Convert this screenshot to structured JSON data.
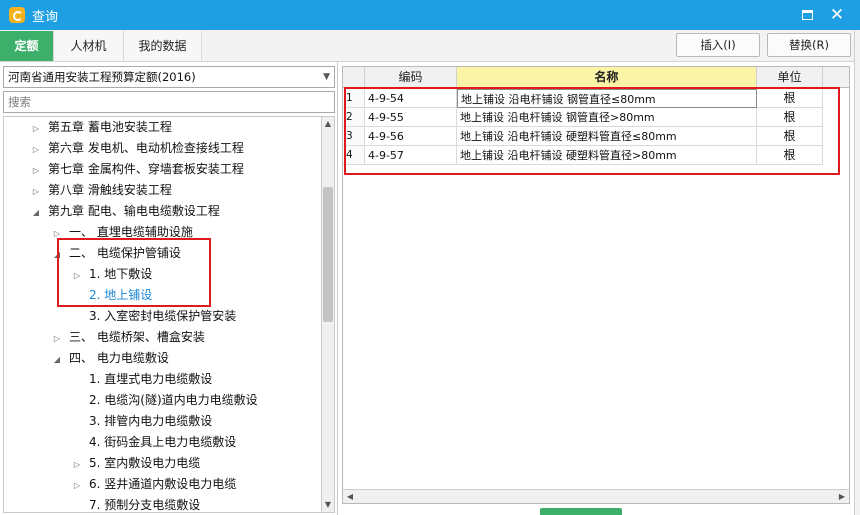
{
  "window": {
    "title": "查询",
    "maximize_icon": "maximize-icon",
    "close_glyph": "✕"
  },
  "tabs": [
    {
      "label": "定额",
      "active": true
    },
    {
      "label": "人材机",
      "active": false
    },
    {
      "label": "我的数据",
      "active": false
    }
  ],
  "toolbar": {
    "insert_label": "插入(I)",
    "replace_label": "替换(R)"
  },
  "left": {
    "quota_book": "河南省通用安装工程预算定额(2016)",
    "search_placeholder": "搜索",
    "tree": [
      {
        "label": "第五章 蓄电池安装工程",
        "level": 0,
        "toggle": "▷"
      },
      {
        "label": "第六章 发电机、电动机检查接线工程",
        "level": 0,
        "toggle": "▷"
      },
      {
        "label": "第七章 金属构件、穿墙套板安装工程",
        "level": 0,
        "toggle": "▷"
      },
      {
        "label": "第八章 滑触线安装工程",
        "level": 0,
        "toggle": "▷"
      },
      {
        "label": "第九章 配电、输电电缆敷设工程",
        "level": 0,
        "toggle": "◢"
      },
      {
        "label": "一、 直埋电缆辅助设施",
        "level": 1,
        "toggle": "▷"
      },
      {
        "label": "二、 电缆保护管铺设",
        "level": 1,
        "toggle": "◢"
      },
      {
        "label": "1. 地下敷设",
        "level": 2,
        "toggle": "▷"
      },
      {
        "label": "2. 地上铺设",
        "level": 2,
        "toggle": "",
        "selected": true
      },
      {
        "label": "3. 入室密封电缆保护管安装",
        "level": 2,
        "toggle": ""
      },
      {
        "label": "三、 电缆桥架、槽盒安装",
        "level": 1,
        "toggle": "▷"
      },
      {
        "label": "四、 电力电缆敷设",
        "level": 1,
        "toggle": "◢"
      },
      {
        "label": "1. 直埋式电力电缆敷设",
        "level": 2,
        "toggle": ""
      },
      {
        "label": "2. 电缆沟(隧)道内电力电缆敷设",
        "level": 2,
        "toggle": ""
      },
      {
        "label": "3. 排管内电力电缆敷设",
        "level": 2,
        "toggle": ""
      },
      {
        "label": "4. 街码金具上电力电缆敷设",
        "level": 2,
        "toggle": ""
      },
      {
        "label": "5. 室内敷设电力电缆",
        "level": 2,
        "toggle": "▷"
      },
      {
        "label": "6. 竖井通道内敷设电力电缆",
        "level": 2,
        "toggle": "▷"
      },
      {
        "label": "7. 预制分支电缆敷设",
        "level": 2,
        "toggle": ""
      }
    ]
  },
  "table": {
    "headers": {
      "code": "编码",
      "name": "名称",
      "unit": "单位"
    },
    "rows": [
      {
        "no": "1",
        "code": "4-9-54",
        "name": "地上铺设 沿电杆铺设 钢管直径≤80mm",
        "unit": "根"
      },
      {
        "no": "2",
        "code": "4-9-55",
        "name": "地上铺设 沿电杆铺设 钢管直径>80mm",
        "unit": "根"
      },
      {
        "no": "3",
        "code": "4-9-56",
        "name": "地上铺设 沿电杆铺设 硬塑料管直径≤80mm",
        "unit": "根"
      },
      {
        "no": "4",
        "code": "4-9-57",
        "name": "地上铺设 沿电杆铺设 硬塑料管直径>80mm",
        "unit": "根"
      }
    ]
  },
  "colors": {
    "titlebar": "#1e9fe3",
    "active_tab": "#3cb06a",
    "highlight_box": "#e0191f",
    "selected_tree_text": "#1a87d3",
    "name_header": "#fbf3a6"
  }
}
